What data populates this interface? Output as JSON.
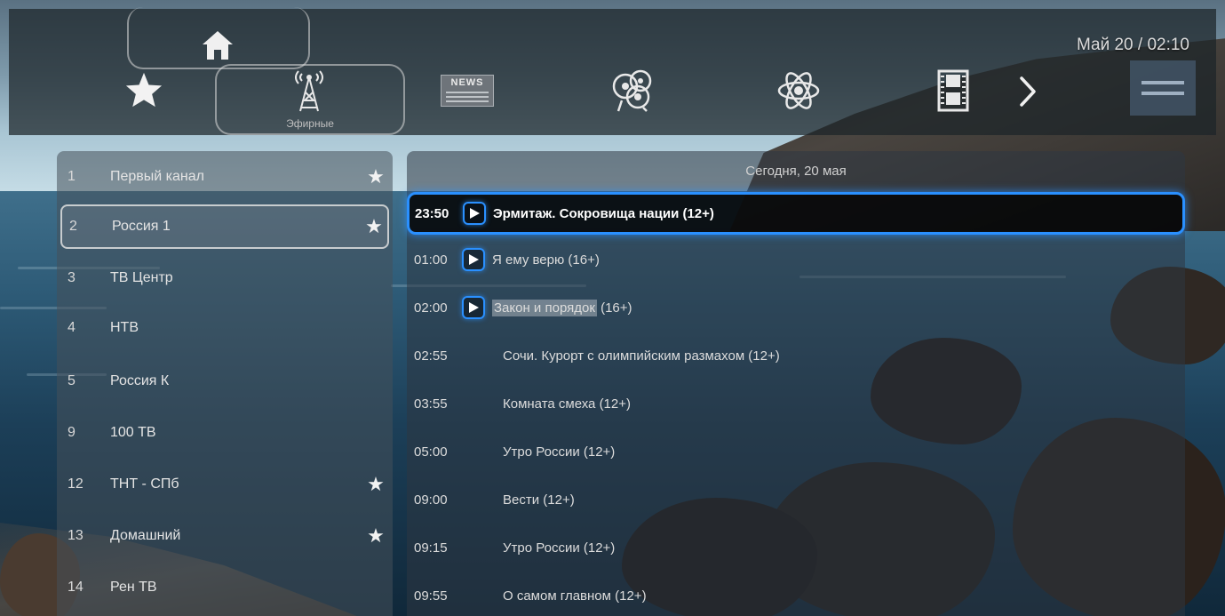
{
  "header": {
    "datetime": "Май 20 / 02:10",
    "menu": [
      {
        "id": "home",
        "icon": "home-icon"
      },
      {
        "id": "favorites",
        "icon": "star-icon"
      },
      {
        "id": "air",
        "icon": "antenna-icon",
        "label": "Эфирные"
      },
      {
        "id": "news",
        "icon": "news-icon",
        "label": "NEWS"
      },
      {
        "id": "entertainment",
        "icon": "entertainment-icon"
      },
      {
        "id": "science",
        "icon": "atom-icon"
      },
      {
        "id": "movies",
        "icon": "film-icon"
      },
      {
        "id": "next",
        "icon": "chevron-right-icon"
      }
    ]
  },
  "channels": [
    {
      "num": "1",
      "name": "Первый канал",
      "favorite": true
    },
    {
      "num": "2",
      "name": "Россия 1",
      "favorite": true,
      "selected": true
    },
    {
      "num": "3",
      "name": "ТВ Центр",
      "favorite": false
    },
    {
      "num": "4",
      "name": "НТВ",
      "favorite": false
    },
    {
      "num": "5",
      "name": "Россия К",
      "favorite": false
    },
    {
      "num": "9",
      "name": "100 ТВ",
      "favorite": false
    },
    {
      "num": "12",
      "name": "ТНТ - СПб",
      "favorite": true
    },
    {
      "num": "13",
      "name": "Домашний",
      "favorite": true
    },
    {
      "num": "14",
      "name": "Рен ТВ",
      "favorite": false
    }
  ],
  "epg": {
    "date": "Сегодня, 20 мая",
    "programs": [
      {
        "time": "23:50",
        "title": "Эрмитаж. Сокровища нации (12+)",
        "playable": true,
        "focused": true
      },
      {
        "time": "01:00",
        "title": "Я ему верю (16+)",
        "playable": true
      },
      {
        "time": "02:00",
        "title_main": "Закон и порядок",
        "title_rest": " (16+)",
        "playable": true,
        "current": true
      },
      {
        "time": "02:55",
        "title": "Сочи. Курорт с олимпийским размахом (12+)",
        "playable": false
      },
      {
        "time": "03:55",
        "title": "Комната смеха (12+)",
        "playable": false
      },
      {
        "time": "05:00",
        "title": "Утро России (12+)",
        "playable": false
      },
      {
        "time": "09:00",
        "title": "Вести (12+)",
        "playable": false
      },
      {
        "time": "09:15",
        "title": "Утро России (12+)",
        "playable": false
      },
      {
        "time": "09:55",
        "title": "О самом главном (12+)",
        "playable": false
      }
    ]
  },
  "colors": {
    "focus": "#2a90ff",
    "panel": "#2d3741",
    "text": "#e6e6e6"
  }
}
